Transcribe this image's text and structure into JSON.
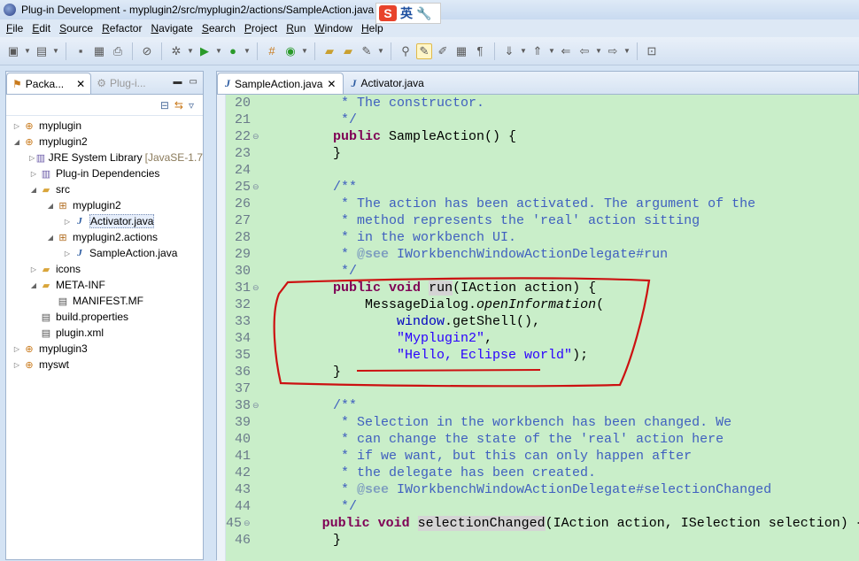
{
  "window": {
    "title": "Plug-in Development - myplugin2/src/myplugin2/actions/SampleAction.java",
    "ime": {
      "logo": "S",
      "lang": "英"
    }
  },
  "menu": [
    "File",
    "Edit",
    "Source",
    "Refactor",
    "Navigate",
    "Search",
    "Project",
    "Run",
    "Window",
    "Help"
  ],
  "left_panel": {
    "tabs": [
      {
        "label": "Packa...",
        "icon": "package-explorer-icon",
        "active": true
      },
      {
        "label": "Plug-i...",
        "icon": "plugins-icon",
        "active": false
      }
    ],
    "tree": [
      {
        "label": "myplugin",
        "level": 0,
        "icon": "project-icon",
        "twisty": "▷"
      },
      {
        "label": "myplugin2",
        "level": 0,
        "icon": "project-icon",
        "twisty": "◢"
      },
      {
        "label": "JRE System Library",
        "decoration": "[JavaSE-1.7",
        "level": 1,
        "icon": "library-icon",
        "twisty": "▷"
      },
      {
        "label": "Plug-in Dependencies",
        "level": 1,
        "icon": "library-icon",
        "twisty": "▷"
      },
      {
        "label": "src",
        "level": 1,
        "icon": "folder-icon",
        "twisty": "◢"
      },
      {
        "label": "myplugin2",
        "level": 2,
        "icon": "package-icon",
        "twisty": "◢"
      },
      {
        "label": "Activator.java",
        "level": 3,
        "icon": "java-file-icon",
        "twisty": "▷",
        "selected": true
      },
      {
        "label": "myplugin2.actions",
        "level": 2,
        "icon": "package-icon",
        "twisty": "◢"
      },
      {
        "label": "SampleAction.java",
        "level": 3,
        "icon": "java-file-icon",
        "twisty": "▷"
      },
      {
        "label": "icons",
        "level": 1,
        "icon": "folder-icon",
        "twisty": "▷"
      },
      {
        "label": "META-INF",
        "level": 1,
        "icon": "folder-icon",
        "twisty": "◢"
      },
      {
        "label": "MANIFEST.MF",
        "level": 2,
        "icon": "file-icon",
        "twisty": ""
      },
      {
        "label": "build.properties",
        "level": 1,
        "icon": "file-icon",
        "twisty": ""
      },
      {
        "label": "plugin.xml",
        "level": 1,
        "icon": "file-icon",
        "twisty": ""
      },
      {
        "label": "myplugin3",
        "level": 0,
        "icon": "project-icon",
        "twisty": "▷"
      },
      {
        "label": "myswt",
        "level": 0,
        "icon": "project-icon",
        "twisty": "▷"
      }
    ]
  },
  "editor": {
    "tabs": [
      {
        "label": "SampleAction.java",
        "active": true,
        "closable": true
      },
      {
        "label": "Activator.java",
        "active": false,
        "closable": false
      }
    ],
    "lines": [
      {
        "n": "20",
        "fold": "",
        "code": "     * The constructor."
      },
      {
        "n": "21",
        "fold": "",
        "code": "     */"
      },
      {
        "n": "22",
        "fold": "⊖",
        "code": "    public SampleAction() {"
      },
      {
        "n": "23",
        "fold": "",
        "code": "    }"
      },
      {
        "n": "24",
        "fold": "",
        "code": ""
      },
      {
        "n": "25",
        "fold": "⊖",
        "code": "    /**"
      },
      {
        "n": "26",
        "fold": "",
        "code": "     * The action has been activated. The argument of the"
      },
      {
        "n": "27",
        "fold": "",
        "code": "     * method represents the 'real' action sitting"
      },
      {
        "n": "28",
        "fold": "",
        "code": "     * in the workbench UI."
      },
      {
        "n": "29",
        "fold": "",
        "code": "     * @see IWorkbenchWindowActionDelegate#run"
      },
      {
        "n": "30",
        "fold": "",
        "code": "     */"
      },
      {
        "n": "31",
        "fold": "⊖",
        "code": "    public void run(IAction action) {"
      },
      {
        "n": "32",
        "fold": "",
        "code": "        MessageDialog.openInformation("
      },
      {
        "n": "33",
        "fold": "",
        "code": "            window.getShell(),"
      },
      {
        "n": "34",
        "fold": "",
        "code": "            \"Myplugin2\","
      },
      {
        "n": "35",
        "fold": "",
        "code": "            \"Hello, Eclipse world\");"
      },
      {
        "n": "36",
        "fold": "",
        "code": "    }"
      },
      {
        "n": "37",
        "fold": "",
        "code": ""
      },
      {
        "n": "38",
        "fold": "⊖",
        "code": "    /**"
      },
      {
        "n": "39",
        "fold": "",
        "code": "     * Selection in the workbench has been changed. We"
      },
      {
        "n": "40",
        "fold": "",
        "code": "     * can change the state of the 'real' action here"
      },
      {
        "n": "41",
        "fold": "",
        "code": "     * if we want, but this can only happen after"
      },
      {
        "n": "42",
        "fold": "",
        "code": "     * the delegate has been created."
      },
      {
        "n": "43",
        "fold": "",
        "code": "     * @see IWorkbenchWindowActionDelegate#selectionChanged"
      },
      {
        "n": "44",
        "fold": "",
        "code": "     */"
      },
      {
        "n": "45",
        "fold": "⊖",
        "code": "    public void selectionChanged(IAction action, ISelection selection) {"
      },
      {
        "n": "46",
        "fold": "",
        "code": "    }"
      }
    ]
  },
  "colors": {
    "editor_bg": "#c9eec9",
    "keyword": "#7f0055",
    "comment": "#3f5fbf",
    "string": "#2a00ff",
    "annotation_red": "#cc1111"
  }
}
